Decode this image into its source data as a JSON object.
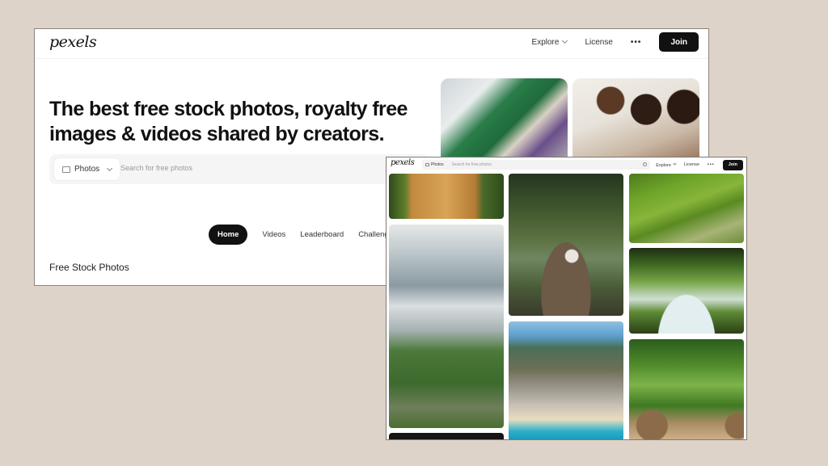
{
  "back": {
    "logo": "pexels",
    "nav": {
      "explore": "Explore",
      "license": "License",
      "more": "•••",
      "join": "Join"
    },
    "hero_title": "The best free stock photos, royalty free images & videos shared by creators.",
    "search": {
      "type": "Photos",
      "placeholder": "Search for free photos"
    },
    "tabs": [
      "Home",
      "Videos",
      "Leaderboard",
      "Challenges"
    ],
    "section_title": "Free Stock Photos"
  },
  "front": {
    "logo": "pexels",
    "search": {
      "type": "Photos",
      "placeholder": "Search for free photos"
    },
    "nav": {
      "explore": "Explore",
      "license": "License",
      "more": "•••",
      "join": "Join"
    }
  },
  "colors": {
    "background": "#ddd3c8",
    "join_button": "#111111",
    "search_bg": "#f5f5f5"
  }
}
